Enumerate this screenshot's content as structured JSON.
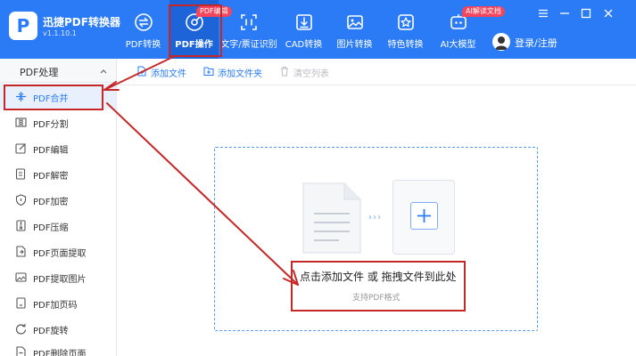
{
  "app": {
    "logo_letter": "P",
    "name": "迅捷PDF转换器",
    "version": "v1.1.10.1"
  },
  "nav": {
    "items": [
      {
        "label": "PDF转换",
        "icon": "swap-icon"
      },
      {
        "label": "PDF操作",
        "icon": "pdf-operation-icon",
        "badge": "PDF编辑"
      },
      {
        "label": "文字/票证识别",
        "icon": "ocr-frame-icon"
      },
      {
        "label": "CAD转换",
        "icon": "cad-icon"
      },
      {
        "label": "图片转换",
        "icon": "image-icon"
      },
      {
        "label": "特色转换",
        "icon": "star-icon"
      },
      {
        "label": "AI大模型",
        "icon": "ai-icon",
        "badge": "AI解读文档"
      }
    ],
    "active": "PDF操作"
  },
  "user": {
    "login_label": "登录/注册"
  },
  "sidebar": {
    "header": "PDF处理",
    "items": [
      {
        "label": "PDF合并",
        "icon": "merge-icon"
      },
      {
        "label": "PDF分割",
        "icon": "split-icon"
      },
      {
        "label": "PDF编辑",
        "icon": "edit-icon"
      },
      {
        "label": "PDF解密",
        "icon": "unlock-icon"
      },
      {
        "label": "PDF加密",
        "icon": "shield-icon"
      },
      {
        "label": "PDF压缩",
        "icon": "compress-icon"
      },
      {
        "label": "PDF页面提取",
        "icon": "page-extract-icon"
      },
      {
        "label": "PDF提取图片",
        "icon": "image-extract-icon"
      },
      {
        "label": "PDF加页码",
        "icon": "page-number-icon"
      },
      {
        "label": "PDF旋转",
        "icon": "rotate-icon"
      },
      {
        "label": "PDF删除页面",
        "icon": "delete-page-icon"
      }
    ],
    "active": "PDF合并"
  },
  "toolbar": {
    "add_file": "添加文件",
    "add_folder": "添加文件夹",
    "clear_list": "清空列表"
  },
  "dropzone": {
    "main_text": "点击添加文件 或 拖拽文件到此处",
    "sub_text": "支持PDF格式",
    "arrows": "›››"
  },
  "colors": {
    "brand": "#2b7bf6",
    "active_nav": "#1d64d9",
    "badge": "#f5455c",
    "annotation": "#c62828"
  }
}
